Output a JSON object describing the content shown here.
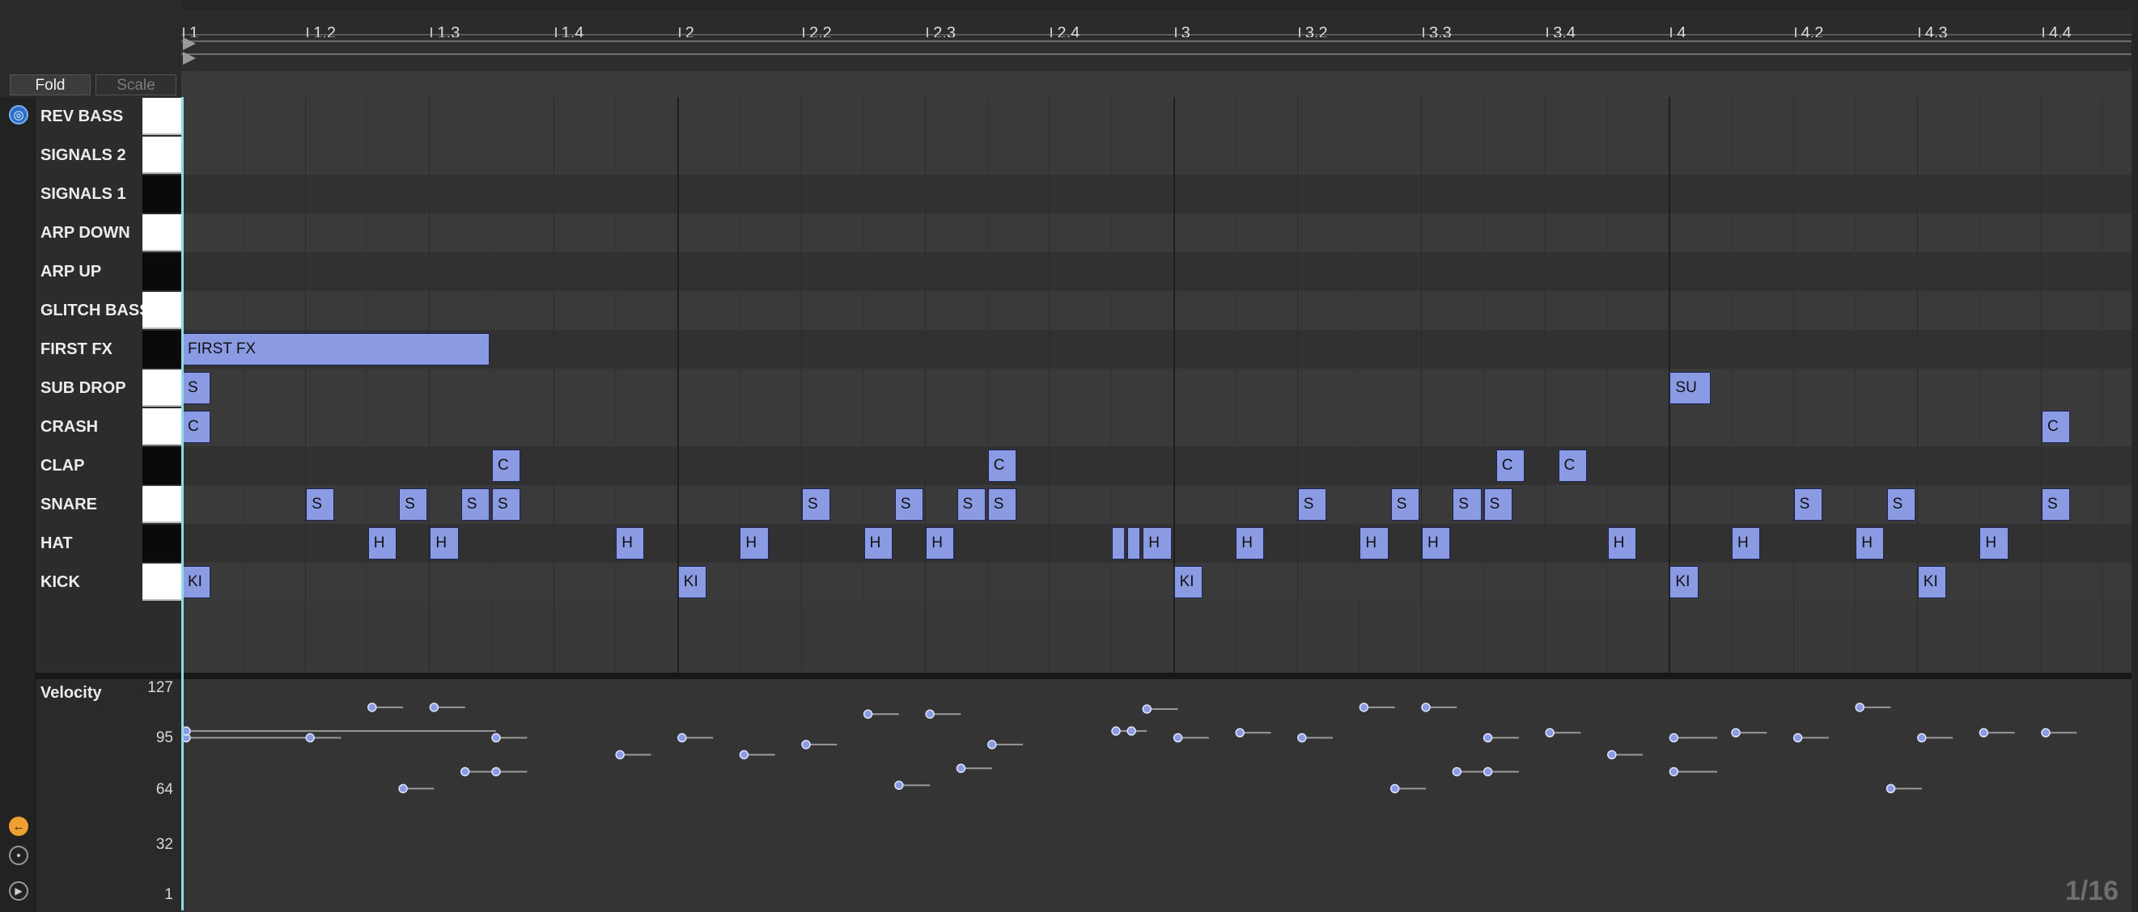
{
  "header": {
    "fold_label": "Fold",
    "scale_label": "Scale"
  },
  "ruler": {
    "labels": [
      "1",
      "1.2",
      "1.3",
      "1.4",
      "2",
      "2.2",
      "2.3",
      "2.4",
      "3",
      "3.2",
      "3.3",
      "3.4",
      "4",
      "4.2",
      "4.3",
      "4.4"
    ]
  },
  "lanes": [
    {
      "name": "REV BASS",
      "key": "white"
    },
    {
      "name": "SIGNALS 2",
      "key": "white"
    },
    {
      "name": "SIGNALS 1",
      "key": "black"
    },
    {
      "name": "ARP DOWN",
      "key": "white"
    },
    {
      "name": "ARP UP",
      "key": "black"
    },
    {
      "name": "GLITCH BASS",
      "key": "white"
    },
    {
      "name": "FIRST FX",
      "key": "black"
    },
    {
      "name": "SUB DROP",
      "key": "white"
    },
    {
      "name": "CRASH",
      "key": "white"
    },
    {
      "name": "CLAP",
      "key": "black"
    },
    {
      "name": "SNARE",
      "key": "white"
    },
    {
      "name": "HAT",
      "key": "black"
    },
    {
      "name": "KICK",
      "key": "white"
    }
  ],
  "notes": [
    {
      "lane": 6,
      "start": 0,
      "len": 5,
      "label": "FIRST FX"
    },
    {
      "lane": 7,
      "start": 0,
      "len": 0.5,
      "label": "S"
    },
    {
      "lane": 7,
      "start": 24,
      "len": 0.7,
      "label": "SU"
    },
    {
      "lane": 8,
      "start": 0,
      "len": 0.5,
      "label": "C"
    },
    {
      "lane": 8,
      "start": 30,
      "len": 0.5,
      "label": "C"
    },
    {
      "lane": 9,
      "start": 5,
      "len": 0.5,
      "label": "C"
    },
    {
      "lane": 9,
      "start": 13,
      "len": 0.5,
      "label": "C"
    },
    {
      "lane": 9,
      "start": 21.2,
      "len": 0.5,
      "label": "C"
    },
    {
      "lane": 9,
      "start": 22.2,
      "len": 0.5,
      "label": "C"
    },
    {
      "lane": 10,
      "start": 2,
      "len": 0.5,
      "label": "S"
    },
    {
      "lane": 10,
      "start": 3.5,
      "len": 0.5,
      "label": "S"
    },
    {
      "lane": 10,
      "start": 4.5,
      "len": 0.5,
      "label": "S"
    },
    {
      "lane": 10,
      "start": 5,
      "len": 0.5,
      "label": "S"
    },
    {
      "lane": 10,
      "start": 10,
      "len": 0.5,
      "label": "S"
    },
    {
      "lane": 10,
      "start": 11.5,
      "len": 0.5,
      "label": "S"
    },
    {
      "lane": 10,
      "start": 12.5,
      "len": 0.5,
      "label": "S"
    },
    {
      "lane": 10,
      "start": 13,
      "len": 0.5,
      "label": "S"
    },
    {
      "lane": 10,
      "start": 18,
      "len": 0.5,
      "label": "S"
    },
    {
      "lane": 10,
      "start": 19.5,
      "len": 0.5,
      "label": "S"
    },
    {
      "lane": 10,
      "start": 20.5,
      "len": 0.5,
      "label": "S"
    },
    {
      "lane": 10,
      "start": 21,
      "len": 0.5,
      "label": "S"
    },
    {
      "lane": 10,
      "start": 26,
      "len": 0.5,
      "label": "S"
    },
    {
      "lane": 10,
      "start": 27.5,
      "len": 0.5,
      "label": "S"
    },
    {
      "lane": 10,
      "start": 30,
      "len": 0.5,
      "label": "S"
    },
    {
      "lane": 11,
      "start": 3,
      "len": 0.5,
      "label": "H"
    },
    {
      "lane": 11,
      "start": 4,
      "len": 0.5,
      "label": "H"
    },
    {
      "lane": 11,
      "start": 7,
      "len": 0.5,
      "label": "H"
    },
    {
      "lane": 11,
      "start": 9,
      "len": 0.5,
      "label": "H"
    },
    {
      "lane": 11,
      "start": 11,
      "len": 0.5,
      "label": "H"
    },
    {
      "lane": 11,
      "start": 12,
      "len": 0.5,
      "label": "H"
    },
    {
      "lane": 11,
      "start": 15,
      "len": 0.25,
      "label": ""
    },
    {
      "lane": 11,
      "start": 15.25,
      "len": 0.25,
      "label": ""
    },
    {
      "lane": 11,
      "start": 15.5,
      "len": 0.5,
      "label": "H"
    },
    {
      "lane": 11,
      "start": 17,
      "len": 0.5,
      "label": "H"
    },
    {
      "lane": 11,
      "start": 19,
      "len": 0.5,
      "label": "H"
    },
    {
      "lane": 11,
      "start": 20,
      "len": 0.5,
      "label": "H"
    },
    {
      "lane": 11,
      "start": 23,
      "len": 0.5,
      "label": "H"
    },
    {
      "lane": 11,
      "start": 25,
      "len": 0.5,
      "label": "H"
    },
    {
      "lane": 11,
      "start": 27,
      "len": 0.5,
      "label": "H"
    },
    {
      "lane": 11,
      "start": 29,
      "len": 0.5,
      "label": "H"
    },
    {
      "lane": 12,
      "start": 0,
      "len": 0.5,
      "label": "KI"
    },
    {
      "lane": 12,
      "start": 8,
      "len": 0.5,
      "label": "KI"
    },
    {
      "lane": 12,
      "start": 16,
      "len": 0.5,
      "label": "KI"
    },
    {
      "lane": 12,
      "start": 24,
      "len": 0.5,
      "label": "KI"
    },
    {
      "lane": 12,
      "start": 28,
      "len": 0.5,
      "label": "KI"
    }
  ],
  "velocity": {
    "title": "Velocity",
    "ticks": [
      "127",
      "95",
      "64",
      "32",
      "1"
    ],
    "points": [
      [
        0,
        100,
        2
      ],
      [
        0,
        104,
        5
      ],
      [
        2,
        100,
        0.5
      ],
      [
        3,
        118,
        0.5
      ],
      [
        3.5,
        70,
        0.5
      ],
      [
        4,
        118,
        0.5
      ],
      [
        4.5,
        80,
        0.5
      ],
      [
        5,
        80,
        0.5
      ],
      [
        5,
        100,
        0.5
      ],
      [
        7,
        90,
        0.5
      ],
      [
        8,
        100,
        0.5
      ],
      [
        9,
        90,
        0.5
      ],
      [
        10,
        96,
        0.5
      ],
      [
        11,
        114,
        0.5
      ],
      [
        11.5,
        72,
        0.5
      ],
      [
        12,
        114,
        0.5
      ],
      [
        12.5,
        82,
        0.5
      ],
      [
        13,
        96,
        0.5
      ],
      [
        15,
        104,
        0.25
      ],
      [
        15.25,
        104,
        0.25
      ],
      [
        15.5,
        117,
        0.5
      ],
      [
        16,
        100,
        0.5
      ],
      [
        17,
        103,
        0.5
      ],
      [
        18,
        100,
        0.5
      ],
      [
        19,
        118,
        0.5
      ],
      [
        19.5,
        70,
        0.5
      ],
      [
        20,
        118,
        0.5
      ],
      [
        20.5,
        80,
        0.5
      ],
      [
        21,
        80,
        0.5
      ],
      [
        21,
        100,
        0.5
      ],
      [
        22,
        103,
        0.5
      ],
      [
        23,
        90,
        0.5
      ],
      [
        24,
        100,
        0.7
      ],
      [
        24,
        80,
        0.7
      ],
      [
        25,
        103,
        0.5
      ],
      [
        26,
        100,
        0.5
      ],
      [
        27,
        118,
        0.5
      ],
      [
        27.5,
        70,
        0.5
      ],
      [
        28,
        100,
        0.5
      ],
      [
        29,
        103,
        0.5
      ],
      [
        30,
        103,
        0.5
      ]
    ]
  },
  "grid_resolution": "1/16",
  "colors": {
    "note": "#8b9be3",
    "playhead": "#8fd9e6",
    "accent": "#f0a030"
  }
}
